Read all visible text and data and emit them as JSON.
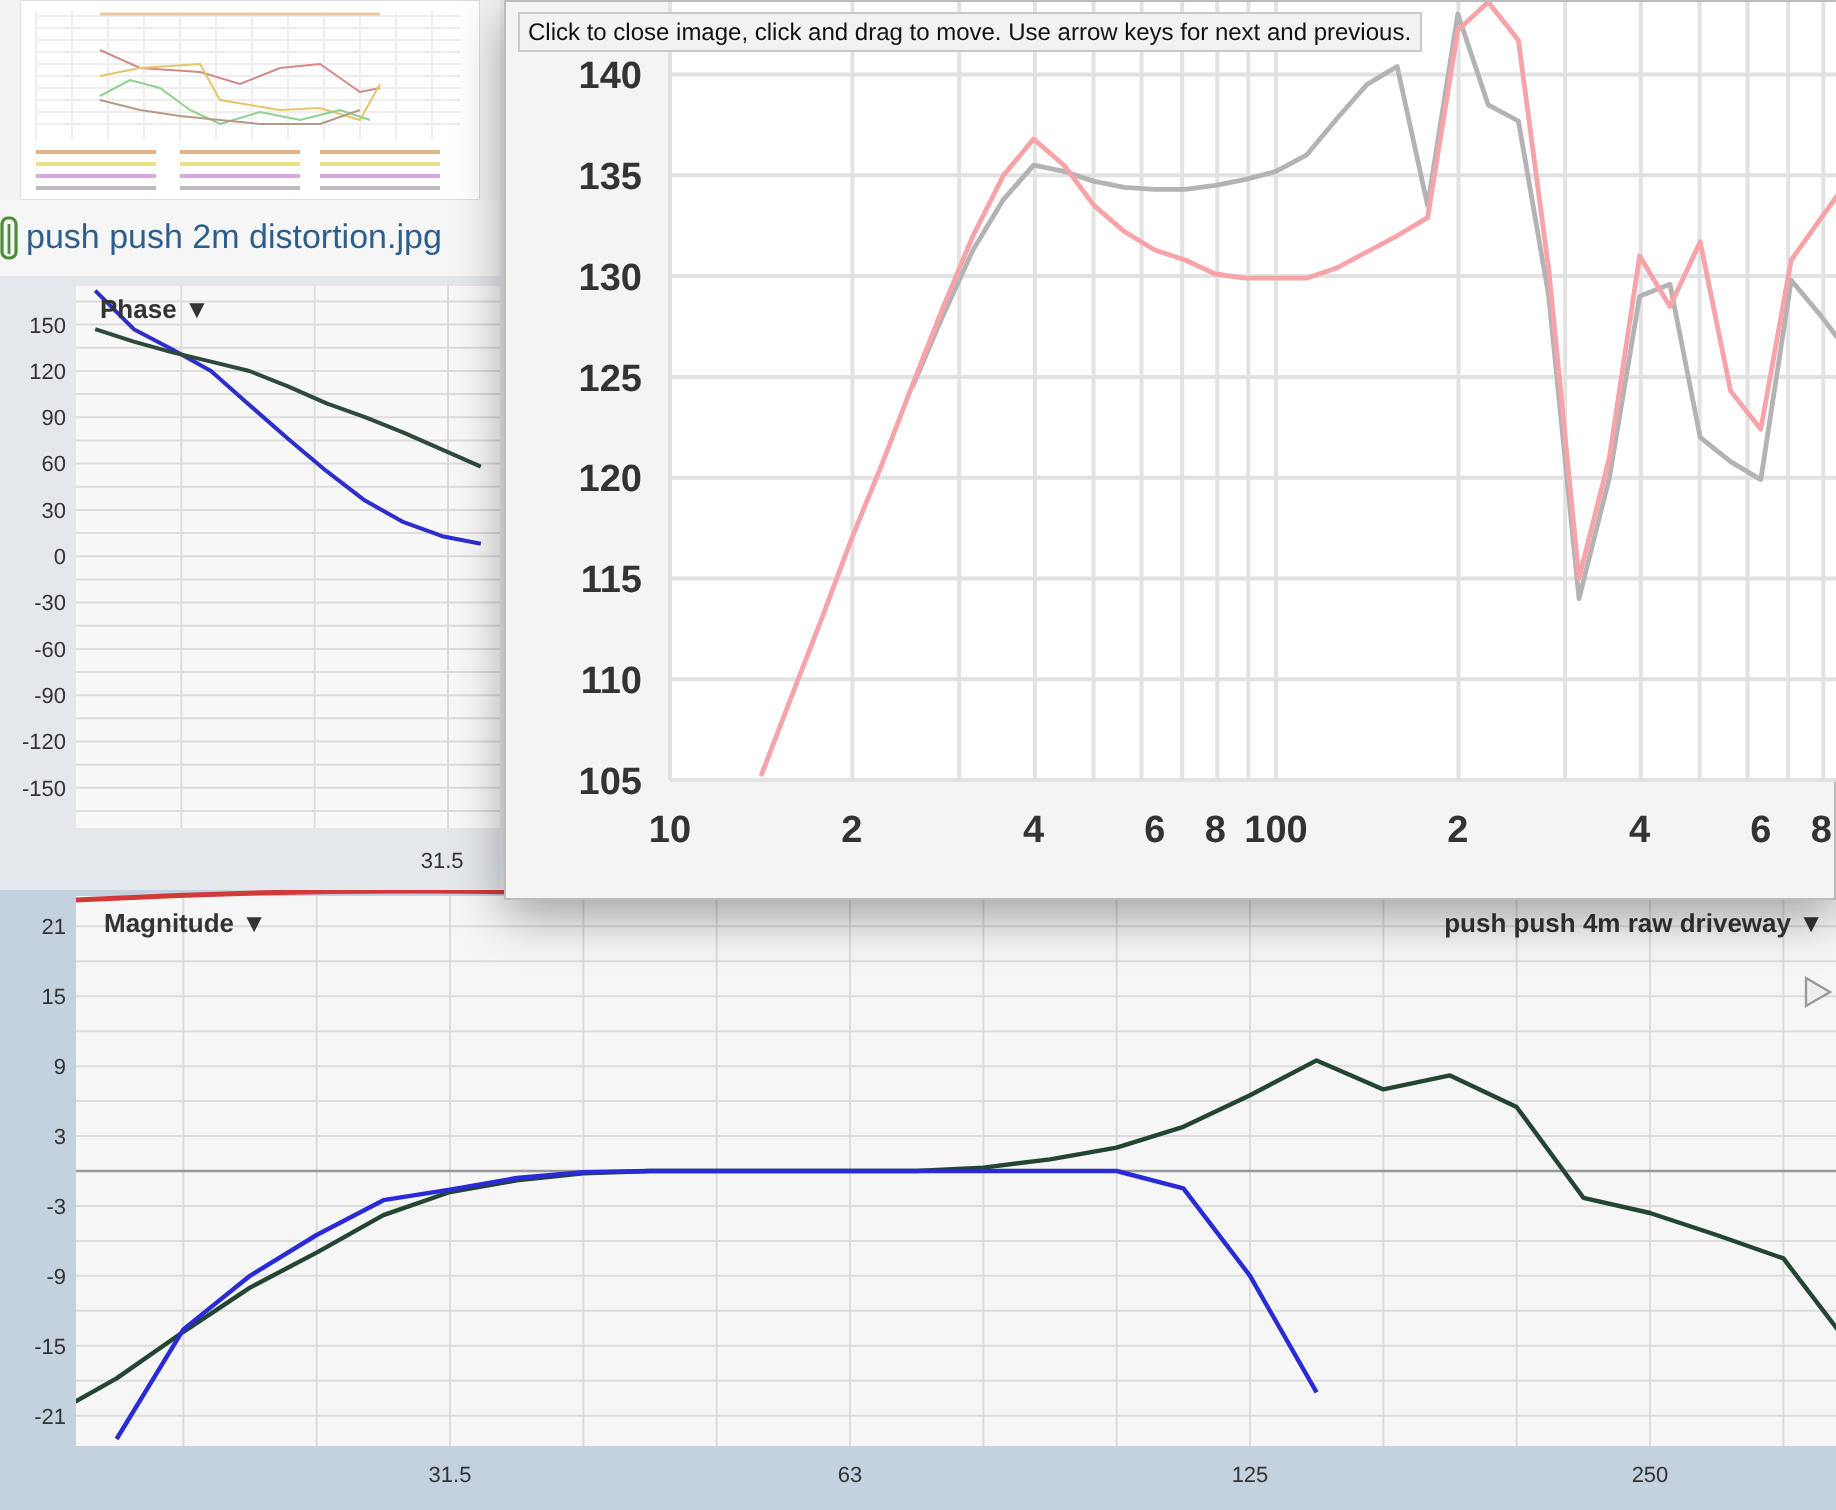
{
  "thumbnail": {
    "filename": "push push 2m distortion.jpg"
  },
  "phase_panel": {
    "selector": {
      "label": "Phase",
      "caret": "▼"
    },
    "chart_data": {
      "type": "line",
      "grid": true,
      "categories": [
        null,
        null,
        null,
        null,
        null,
        null,
        null,
        null,
        null,
        "31.5",
        null
      ],
      "series": [
        {
          "color": "#2e2ecc",
          "values": [
            172,
            147,
            134,
            120,
            98,
            76,
            55,
            36,
            22,
            13,
            8
          ]
        },
        {
          "color": "#2d4a3a",
          "values": [
            147,
            139,
            132,
            126,
            120,
            110,
            99,
            90,
            80,
            69,
            58
          ]
        }
      ],
      "ylim": [
        -176,
        175
      ],
      "yticks": [
        150,
        120,
        90,
        60,
        30,
        0,
        -30,
        -60,
        -90,
        -120,
        -150
      ]
    }
  },
  "magnitude_panel": {
    "selector": {
      "label": "Magnitude",
      "caret": "▼"
    },
    "measurement_selector": {
      "label": "push push 4m raw driveway",
      "caret": "▼"
    },
    "chart_data": {
      "type": "line",
      "grid": true,
      "categories": [
        null,
        null,
        null,
        null,
        null,
        null,
        "31.5",
        null,
        null,
        null,
        null,
        null,
        "63",
        null,
        null,
        null,
        null,
        null,
        "125",
        null,
        null,
        null,
        null,
        null,
        "250",
        null,
        null,
        null
      ],
      "series": [
        {
          "color": "#234532",
          "values": [
            -21,
            -17.8,
            -13.8,
            -10,
            -7,
            -3.8,
            -1.8,
            -0.8,
            -0.2,
            0,
            0,
            0,
            0,
            0,
            0.3,
            1,
            2,
            3.8,
            6.5,
            9.5,
            7,
            8.2,
            5.5,
            -2.3,
            -3.6,
            -5.5,
            -7.5,
            -15
          ]
        },
        {
          "color": "#2a2ad6",
          "values": [
            null,
            -23,
            -13.6,
            -9,
            -5.5,
            -2.5,
            -1.6,
            -0.6,
            -0.1,
            0,
            0,
            0,
            0,
            0,
            0,
            0,
            0,
            -1.5,
            -9,
            -19,
            null,
            null,
            null,
            null,
            null,
            null,
            null,
            null
          ]
        }
      ],
      "ylim": [
        -23.6,
        23.6
      ],
      "yticks": [
        21,
        15,
        9,
        3,
        -3,
        -9,
        -15,
        -21
      ]
    }
  },
  "image_viewer": {
    "tooltip": "Click to close image, click and drag to move. Use arrow keys for next and previous.",
    "chart_data": {
      "type": "line",
      "grid": true,
      "categories": [
        "10",
        null,
        null,
        null,
        null,
        null,
        "2",
        null,
        null,
        null,
        null,
        null,
        "4",
        null,
        null,
        null,
        "6",
        null,
        "8",
        null,
        "100",
        null,
        null,
        null,
        null,
        null,
        "2",
        null,
        null,
        null,
        null,
        null,
        "4",
        null,
        null,
        null,
        "6",
        null,
        "8",
        null
      ],
      "series": [
        {
          "color": "#b3b3b3",
          "values": [
            null,
            null,
            null,
            null,
            null,
            null,
            null,
            null,
            124.5,
            128,
            131.3,
            133.8,
            135.5,
            135.2,
            134.7,
            134.4,
            134.3,
            134.3,
            134.5,
            134.8,
            135.2,
            136,
            137.8,
            139.5,
            140.4,
            133.5,
            143,
            138.5,
            137.7,
            129,
            114,
            120,
            129,
            129.6,
            122,
            120.8,
            119.9,
            129.8,
            128,
            126
          ]
        },
        {
          "color": "#f7a3a8",
          "values": [
            null,
            null,
            null,
            105.2,
            109.1,
            113,
            117,
            120.7,
            124.6,
            128.4,
            132,
            135,
            136.8,
            135.5,
            133.5,
            132.2,
            131.3,
            130.8,
            130.1,
            129.9,
            129.9,
            129.9,
            130.4,
            131.2,
            132,
            132.9,
            142.2,
            143.6,
            141.7,
            130.3,
            115,
            121,
            131,
            128.5,
            131.7,
            124.3,
            122.4,
            130.8,
            132.9,
            135
          ]
        }
      ],
      "ylim": [
        105,
        143.6
      ],
      "yticks": [
        140,
        135,
        130,
        125,
        120,
        115,
        110,
        105
      ]
    }
  }
}
